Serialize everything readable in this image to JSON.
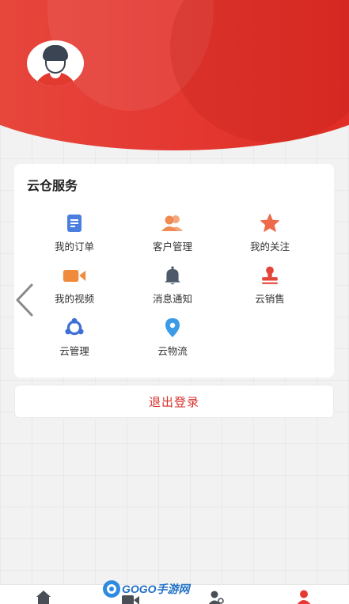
{
  "services": {
    "title": "云仓服务",
    "items": [
      {
        "label": "我的订单",
        "icon": "order-doc-icon",
        "color": "#4a7fe0"
      },
      {
        "label": "客户管理",
        "icon": "customers-icon",
        "color": "#ee8a52"
      },
      {
        "label": "我的关注",
        "icon": "star-icon",
        "color": "#ee6a4a"
      },
      {
        "label": "我的视频",
        "icon": "video-camera-icon",
        "color": "#f08a3c"
      },
      {
        "label": "消息通知",
        "icon": "bell-icon",
        "color": "#4e5a6b"
      },
      {
        "label": "云销售",
        "icon": "stamp-icon",
        "color": "#e4453a"
      },
      {
        "label": "云管理",
        "icon": "network-icon",
        "color": "#3e6fd6"
      },
      {
        "label": "云物流",
        "icon": "location-pin-icon",
        "color": "#3b9be6"
      }
    ]
  },
  "logout_label": "退出登录",
  "watermark_text": "GOGO手游网",
  "colors": {
    "brand_red": "#e43a33",
    "logout_text": "#d9312b"
  }
}
